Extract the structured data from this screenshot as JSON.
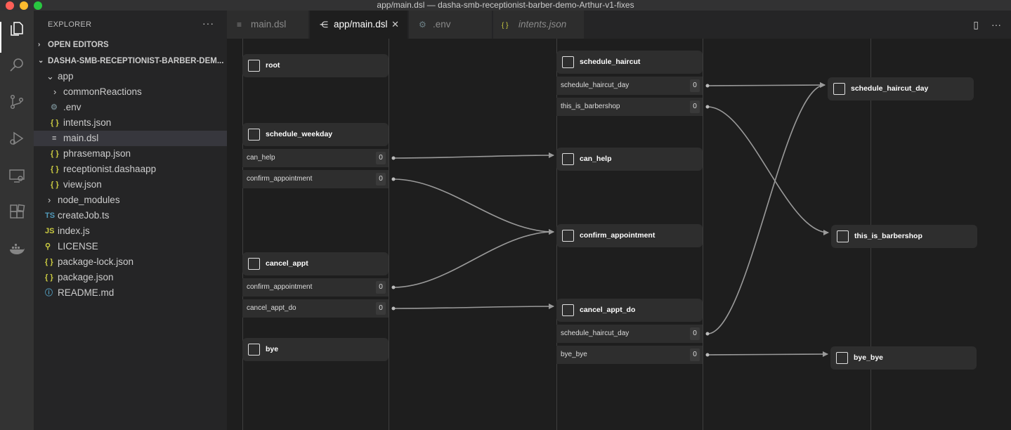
{
  "window": {
    "title": "app/main.dsl — dasha-smb-receptionist-barber-demo-Arthur-v1-fixes"
  },
  "colors": {
    "close": "#ff5f57",
    "minimize": "#febc2e",
    "maximize": "#28c840",
    "json_icon": "#cbcb41",
    "ts_icon": "#519aba",
    "js_icon": "#cbcb41",
    "license_icon": "#cbcb41",
    "readme_icon": "#519aba",
    "gear_icon": "#6d8086"
  },
  "activity_bar": {
    "items": [
      {
        "name": "files-icon"
      },
      {
        "name": "search-icon"
      },
      {
        "name": "source-control-icon"
      },
      {
        "name": "run-debug-icon"
      },
      {
        "name": "remote-explorer-icon"
      },
      {
        "name": "extensions-icon"
      },
      {
        "name": "docker-icon"
      }
    ]
  },
  "sidebar": {
    "title": "EXPLORER",
    "more": "···",
    "open_editors": "OPEN EDITORS",
    "project": "DASHA-SMB-RECEPTIONIST-BARBER-DEM...",
    "tree": [
      {
        "label": "app",
        "icon": "chevron-down-icon",
        "glyph": "⌄"
      },
      {
        "label": "commonReactions",
        "icon": "chevron-right-icon",
        "glyph": "›"
      },
      {
        "label": ".env",
        "icon": "gear-icon",
        "glyph": "⚙"
      },
      {
        "label": "intents.json",
        "icon": "json-icon",
        "glyph": "{ }"
      },
      {
        "label": "main.dsl",
        "icon": "lines-icon",
        "glyph": "≡"
      },
      {
        "label": "phrasemap.json",
        "icon": "json-icon",
        "glyph": "{ }"
      },
      {
        "label": "receptionist.dashaapp",
        "icon": "json-icon",
        "glyph": "{ }"
      },
      {
        "label": "view.json",
        "icon": "json-icon",
        "glyph": "{ }"
      },
      {
        "label": "node_modules",
        "icon": "chevron-right-icon",
        "glyph": "›"
      },
      {
        "label": "createJob.ts",
        "icon": "ts-icon",
        "glyph": "TS"
      },
      {
        "label": "index.js",
        "icon": "js-icon",
        "glyph": "JS"
      },
      {
        "label": "LICENSE",
        "icon": "license-icon",
        "glyph": "⚲"
      },
      {
        "label": "package-lock.json",
        "icon": "json-icon",
        "glyph": "{ }"
      },
      {
        "label": "package.json",
        "icon": "json-icon",
        "glyph": "{ }"
      },
      {
        "label": "README.md",
        "icon": "info-icon",
        "glyph": "ⓘ"
      }
    ]
  },
  "tabs": [
    {
      "label": "main.dsl",
      "icon": "lines-icon",
      "glyph": "≡"
    },
    {
      "label": "app/main.dsl",
      "icon": "graph-icon",
      "glyph": "⋲",
      "close": "✕"
    },
    {
      "label": ".env",
      "icon": "gear-icon",
      "glyph": "⚙"
    },
    {
      "label": "intents.json",
      "icon": "json-icon",
      "glyph": "{ }"
    }
  ],
  "tab_actions": {
    "split": "▯",
    "more": "···"
  },
  "graph": {
    "nodes": [
      {
        "id": "root",
        "title": "root",
        "transitions": []
      },
      {
        "id": "schedule_weekday",
        "title": "schedule_weekday",
        "transitions": [
          {
            "label": "can_help",
            "count": "0"
          },
          {
            "label": "confirm_appointment",
            "count": "0"
          }
        ]
      },
      {
        "id": "cancel_appt",
        "title": "cancel_appt",
        "transitions": [
          {
            "label": "confirm_appointment",
            "count": "0"
          },
          {
            "label": "cancel_appt_do",
            "count": "0"
          }
        ]
      },
      {
        "id": "bye",
        "title": "bye",
        "transitions": []
      },
      {
        "id": "schedule_haircut",
        "title": "schedule_haircut",
        "transitions": [
          {
            "label": "schedule_haircut_day",
            "count": "0"
          },
          {
            "label": "this_is_barbershop",
            "count": "0"
          }
        ]
      },
      {
        "id": "can_help",
        "title": "can_help",
        "transitions": []
      },
      {
        "id": "confirm_appointment",
        "title": "confirm_appointment",
        "transitions": []
      },
      {
        "id": "cancel_appt_do",
        "title": "cancel_appt_do",
        "transitions": [
          {
            "label": "schedule_haircut_day",
            "count": "0"
          },
          {
            "label": "bye_bye",
            "count": "0"
          }
        ]
      },
      {
        "id": "schedule_haircut_day",
        "title": "schedule_haircut_day",
        "transitions": []
      },
      {
        "id": "this_is_barbershop",
        "title": "this_is_barbershop",
        "transitions": []
      },
      {
        "id": "bye_bye",
        "title": "bye_bye",
        "transitions": []
      }
    ],
    "edges": [
      {
        "from": "schedule_weekday",
        "transition": 0,
        "to": "can_help"
      },
      {
        "from": "schedule_weekday",
        "transition": 1,
        "to": "confirm_appointment"
      },
      {
        "from": "cancel_appt",
        "transition": 0,
        "to": "confirm_appointment"
      },
      {
        "from": "cancel_appt",
        "transition": 1,
        "to": "cancel_appt_do"
      },
      {
        "from": "schedule_haircut",
        "transition": 0,
        "to": "schedule_haircut_day"
      },
      {
        "from": "schedule_haircut",
        "transition": 1,
        "to": "this_is_barbershop"
      },
      {
        "from": "cancel_appt_do",
        "transition": 0,
        "to": "schedule_haircut_day"
      },
      {
        "from": "cancel_appt_do",
        "transition": 1,
        "to": "bye_bye"
      }
    ]
  }
}
